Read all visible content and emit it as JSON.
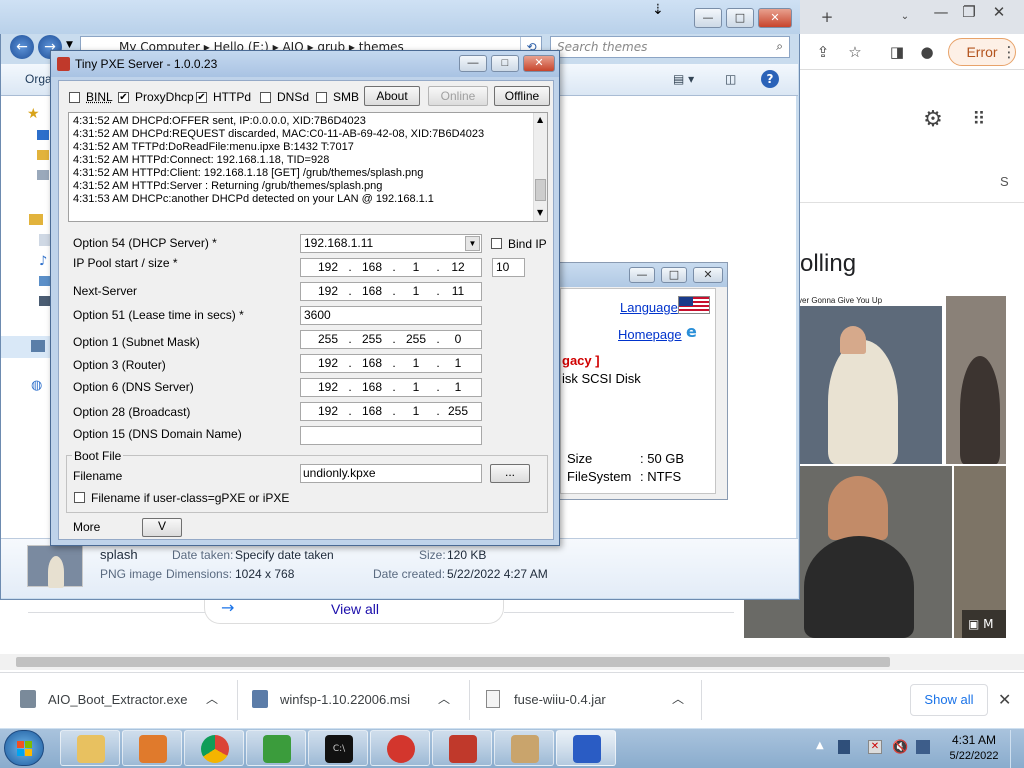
{
  "explorer": {
    "breadcrumb": [
      "My Computer",
      "Hello (E:)",
      "AIO",
      "grub",
      "themes"
    ],
    "search_placeholder": "Search themes",
    "cmd_organize": "Orga",
    "details": {
      "name": "splash",
      "type": "PNG image",
      "date_taken_label": "Date taken:",
      "date_taken_value": "Specify date taken",
      "dimensions_label": "Dimensions:",
      "dimensions_value": "1024 x 768",
      "size_label": "Size:",
      "size_value": "120 KB",
      "date_created_label": "Date created:",
      "date_created_value": "5/22/2022 4:27 AM"
    }
  },
  "props": {
    "language_link": "Language",
    "homepage_link": "Homepage",
    "legacy_text": "gacy ]",
    "disk_text": "isk SCSI Disk",
    "size_label": "Size",
    "size_value": ": 50 GB",
    "fs_label": "FileSystem",
    "fs_value": ": NTFS"
  },
  "pxe": {
    "title": "Tiny PXE Server - 1.0.0.23",
    "checks": {
      "binl": {
        "label": "BINL",
        "checked": false
      },
      "proxydhcp": {
        "label": "ProxyDhcp",
        "checked": true
      },
      "httpd": {
        "label": "HTTPd",
        "checked": true
      },
      "dnsd": {
        "label": "DNSd",
        "checked": false
      },
      "smb": {
        "label": "SMB",
        "checked": false
      }
    },
    "buttons": {
      "about": "About",
      "online": "Online",
      "offline": "Offline",
      "browse": "...",
      "more": "V"
    },
    "log": [
      "4:31:52 AM DHCPd:OFFER sent, IP:0.0.0.0, XID:7B6D4023",
      "4:31:52 AM DHCPd:REQUEST discarded, MAC:C0-11-AB-69-42-08, XID:7B6D4023",
      "4:31:52 AM TFTPd:DoReadFile:menu.ipxe B:1432 T:7017",
      "4:31:52 AM HTTPd:Connect: 192.168.1.18, TID=928",
      "4:31:52 AM HTTPd:Client: 192.168.1.18 [GET] /grub/themes/splash.png",
      "4:31:52 AM HTTPd:Server : Returning /grub/themes/splash.png",
      "4:31:53 AM DHCPc:another DHCPd detected on your LAN @ 192.168.1.1"
    ],
    "labels": {
      "opt54": "Option 54 (DHCP Server) *",
      "pool": "IP Pool start / size *",
      "nextserver": "Next-Server",
      "opt51": "Option 51 (Lease time in secs) *",
      "opt1": "Option 1  (Subnet Mask)",
      "opt3": "Option 3  (Router)",
      "opt6": "Option 6  (DNS Server)",
      "opt28": "Option 28 (Broadcast)",
      "opt15": "Option 15 (DNS Domain Name)",
      "bindip": "Bind IP",
      "bootfile": "Boot File",
      "filename": "Filename",
      "userclass": "Filename if user-class=gPXE or iPXE",
      "more": "More"
    },
    "values": {
      "opt54": "192.168.1.11",
      "pool_ip": [
        "192",
        "168",
        "1",
        "12"
      ],
      "pool_size": "10",
      "nextserver": [
        "192",
        "168",
        "1",
        "11"
      ],
      "opt51": "3600",
      "opt1": [
        "255",
        "255",
        "255",
        "0"
      ],
      "opt3": [
        "192",
        "168",
        "1",
        "1"
      ],
      "opt6": [
        "192",
        "168",
        "1",
        "1"
      ],
      "opt28": [
        "192",
        "168",
        "1",
        "255"
      ],
      "opt15": "",
      "filename": "undionly.kpxe"
    }
  },
  "chrome": {
    "new_tab": "+",
    "error_label": "Error",
    "heading_partial": "olling",
    "video_caption": "ver Gonna Give You Up",
    "view_all": "View all",
    "overlay_letter": "M",
    "side_letter": "S"
  },
  "downloads": [
    {
      "name": "AIO_Boot_Extractor.exe"
    },
    {
      "name": "winfsp-1.10.22006.msi"
    },
    {
      "name": "fuse-wiiu-0.4.jar"
    }
  ],
  "downloads_show_all": "Show all",
  "taskbar": {
    "time": "4:31 AM",
    "date": "5/22/2022"
  }
}
